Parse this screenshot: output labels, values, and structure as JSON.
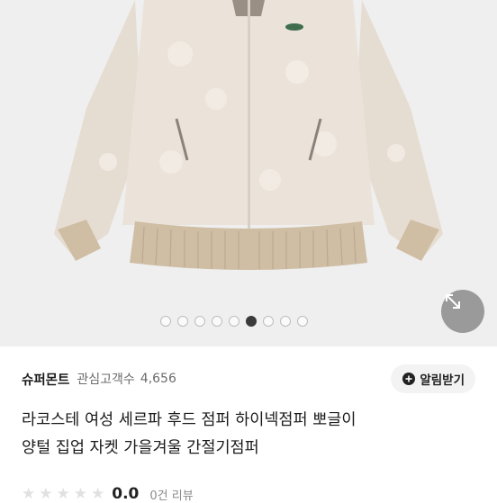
{
  "gallery": {
    "total": 9,
    "active_index": 5,
    "expand_icon": "expand-arrows-icon"
  },
  "seller": {
    "name": "슈퍼몬트",
    "fans_label": "관심고객수",
    "fans_count": "4,656",
    "alarm_label": "알림받기",
    "alarm_icon": "plus-bell-icon"
  },
  "product": {
    "title_line1": "라코스테 여성 세르파 후드 점퍼 하이넥점퍼 뽀글이",
    "title_line2": "양털 집업 자켓 가을겨울 간절기점퍼"
  },
  "rating": {
    "stars": 5,
    "value": "0.0",
    "review_count": "0건 리뷰"
  },
  "colors": {
    "active_dot": "#3a3a3a",
    "jacket": "#ebe3d9",
    "rib": "#cfbea4"
  }
}
